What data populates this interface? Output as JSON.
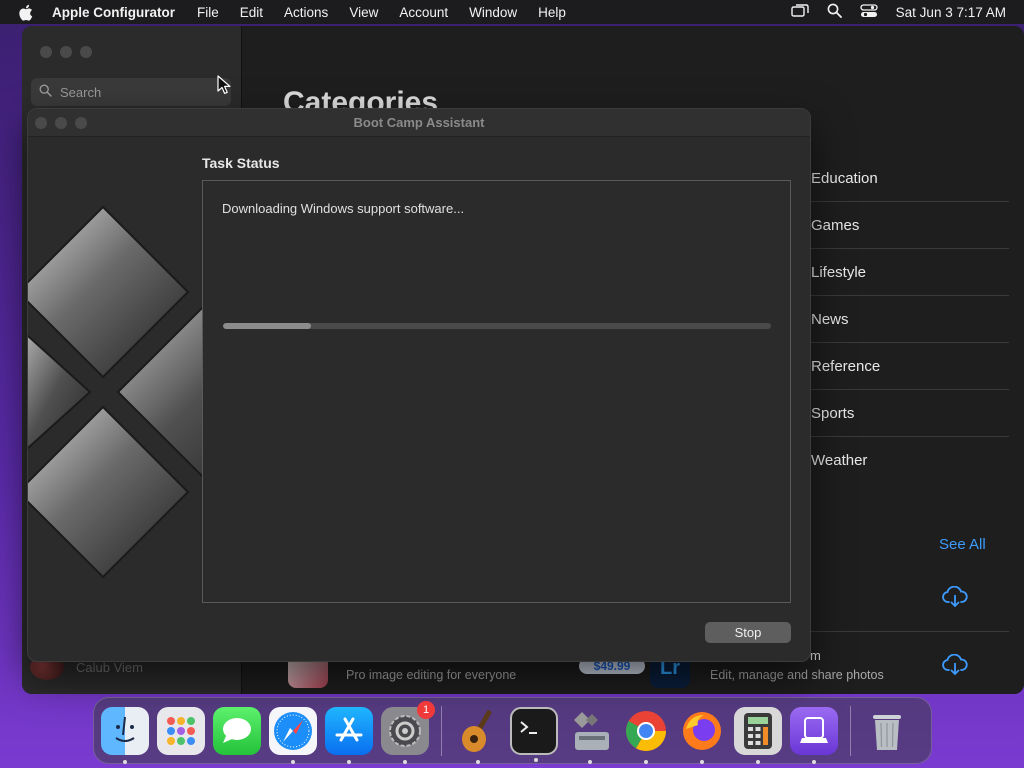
{
  "menubar": {
    "app_name": "Apple Configurator",
    "items": [
      "File",
      "Edit",
      "Actions",
      "View",
      "Account",
      "Window",
      "Help"
    ],
    "clock": "Sat Jun 3  7:17 AM"
  },
  "configurator": {
    "search_placeholder": "Search",
    "heading": "Categories",
    "categories": [
      "Education",
      "Games",
      "Lifestyle",
      "News",
      "Reference",
      "Sports",
      "Weather"
    ],
    "see_all": "See All",
    "user_name": "Calub Viem",
    "app_row": {
      "subtitle_left": "Pro image editing for everyone",
      "price": "$49.99",
      "lr_label": "Lr",
      "title_right_fragment": "m",
      "subtitle_right": "Edit, manage and share photos"
    }
  },
  "bootcamp": {
    "title": "Boot Camp Assistant",
    "section_title": "Task Status",
    "status": "Downloading Windows support software...",
    "progress_fraction": 0.16,
    "stop_label": "Stop"
  },
  "dock": {
    "items": [
      "finder",
      "launchpad",
      "messages",
      "safari",
      "app-store",
      "system-settings",
      "garageband",
      "terminal",
      "boot-camp-assistant",
      "chrome",
      "firefox",
      "calculator",
      "apple-configurator",
      "trash"
    ],
    "system_settings_badge": "1"
  },
  "colors": {
    "accent_link": "#3d9bff",
    "badge_red": "#f03a3a"
  }
}
